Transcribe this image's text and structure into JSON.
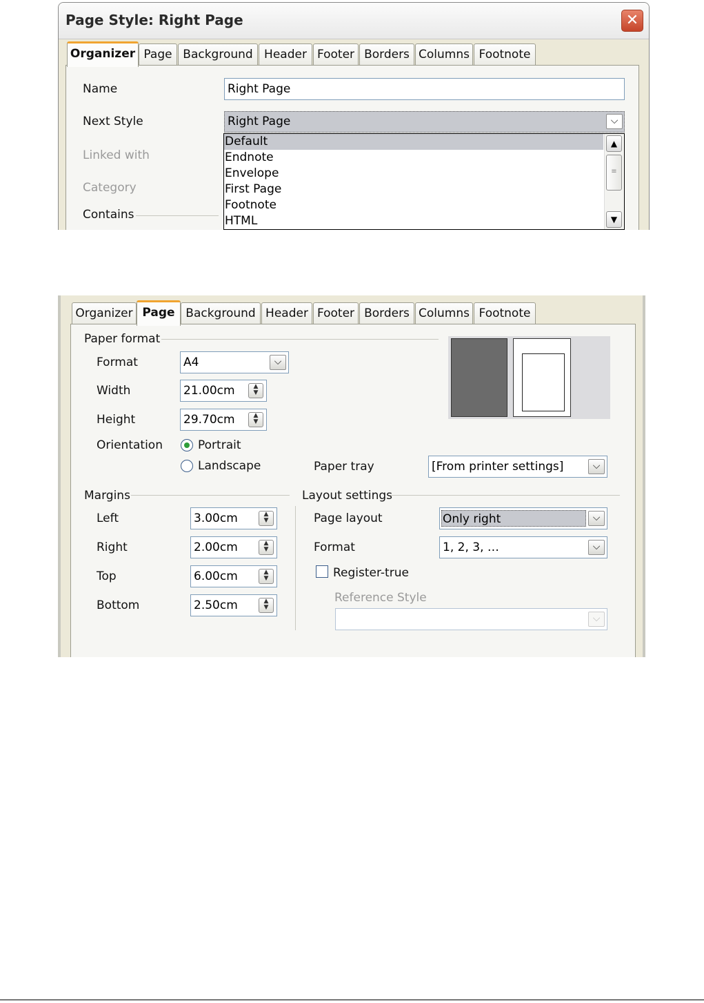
{
  "dialog1": {
    "title": "Page Style: Right Page",
    "close_glyph": "✕",
    "tabs": [
      "Organizer",
      "Page",
      "Background",
      "Header",
      "Footer",
      "Borders",
      "Columns",
      "Footnote"
    ],
    "active_tab": "Organizer",
    "name_label": "Name",
    "name_value": "Right Page",
    "next_style_label": "Next Style",
    "next_style_value": "Right Page",
    "linked_with_label": "Linked with",
    "category_label": "Category",
    "contains_label": "Contains",
    "dropdown_options": [
      "Default",
      "Endnote",
      "Envelope",
      "First Page",
      "Footnote",
      "HTML"
    ],
    "dropdown_highlighted": "Default"
  },
  "dialog2": {
    "tabs": [
      "Organizer",
      "Page",
      "Background",
      "Header",
      "Footer",
      "Borders",
      "Columns",
      "Footnote"
    ],
    "active_tab": "Page",
    "paper_format": {
      "group_label": "Paper format",
      "format_label": "Format",
      "format_value": "A4",
      "width_label": "Width",
      "width_value": "21.00cm",
      "height_label": "Height",
      "height_value": "29.70cm",
      "orientation_label": "Orientation",
      "portrait_label": "Portrait",
      "landscape_label": "Landscape",
      "orientation_selected": "Portrait",
      "paper_tray_label": "Paper tray",
      "paper_tray_value": "[From printer settings]"
    },
    "margins": {
      "group_label": "Margins",
      "left_label": "Left",
      "left_value": "3.00cm",
      "right_label": "Right",
      "right_value": "2.00cm",
      "top_label": "Top",
      "top_value": "6.00cm",
      "bottom_label": "Bottom",
      "bottom_value": "2.50cm"
    },
    "layout": {
      "group_label": "Layout settings",
      "page_layout_label": "Page layout",
      "page_layout_value": "Only right",
      "format_label": "Format",
      "format_value": "1, 2, 3, …",
      "register_true_label": "Register-true",
      "register_true_checked": false,
      "reference_style_label": "Reference Style",
      "reference_style_value": ""
    }
  },
  "colors": {
    "dialog_bg": "#ece9d8",
    "active_tab_accent": "#f0a430",
    "selection": "#c7c9cf",
    "radio_dot": "#2f9d3a",
    "close_button": "#d0583c"
  }
}
